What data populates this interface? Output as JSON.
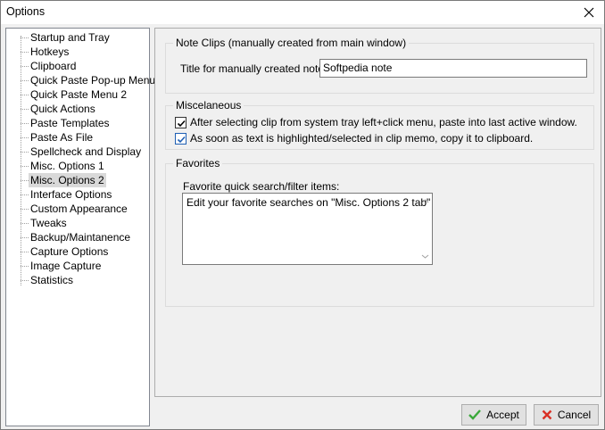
{
  "window": {
    "title": "Options"
  },
  "tree": {
    "items": [
      {
        "label": "Startup and Tray"
      },
      {
        "label": "Hotkeys"
      },
      {
        "label": "Clipboard"
      },
      {
        "label": "Quick Paste Pop-up Menu"
      },
      {
        "label": "Quick Paste Menu 2"
      },
      {
        "label": "Quick Actions"
      },
      {
        "label": "Paste Templates"
      },
      {
        "label": "Paste As File"
      },
      {
        "label": "Spellcheck and Display"
      },
      {
        "label": "Misc. Options 1"
      },
      {
        "label": "Misc. Options 2"
      },
      {
        "label": "Interface Options"
      },
      {
        "label": "Custom Appearance"
      },
      {
        "label": "Tweaks"
      },
      {
        "label": "Backup/Maintanence"
      },
      {
        "label": "Capture Options"
      },
      {
        "label": "Image Capture"
      },
      {
        "label": "Statistics"
      }
    ],
    "selected": "Misc. Options 2"
  },
  "note_clips": {
    "group_title": "Note Clips (manually created from main window)",
    "title_label": "Title for manually created notes:",
    "title_value": "Softpedia note"
  },
  "misc": {
    "group_title": "Miscelaneous",
    "check1_label": "After selecting clip from system tray left+click menu, paste into last active window.",
    "check1_checked": true,
    "check2_label": "As soon as text is highlighted/selected in clip memo, copy it to clipboard.",
    "check2_checked": true
  },
  "favorites": {
    "group_title": "Favorites",
    "memo_label": "Favorite quick search/filter items:",
    "memo_value": "Edit your favorite searches on \"Misc. Options 2 tab\""
  },
  "buttons": {
    "accept": "Accept",
    "cancel": "Cancel"
  },
  "colors": {
    "accept_icon": "#3aa83a",
    "cancel_icon": "#d93025",
    "check_mark": "#1e5fb4"
  }
}
